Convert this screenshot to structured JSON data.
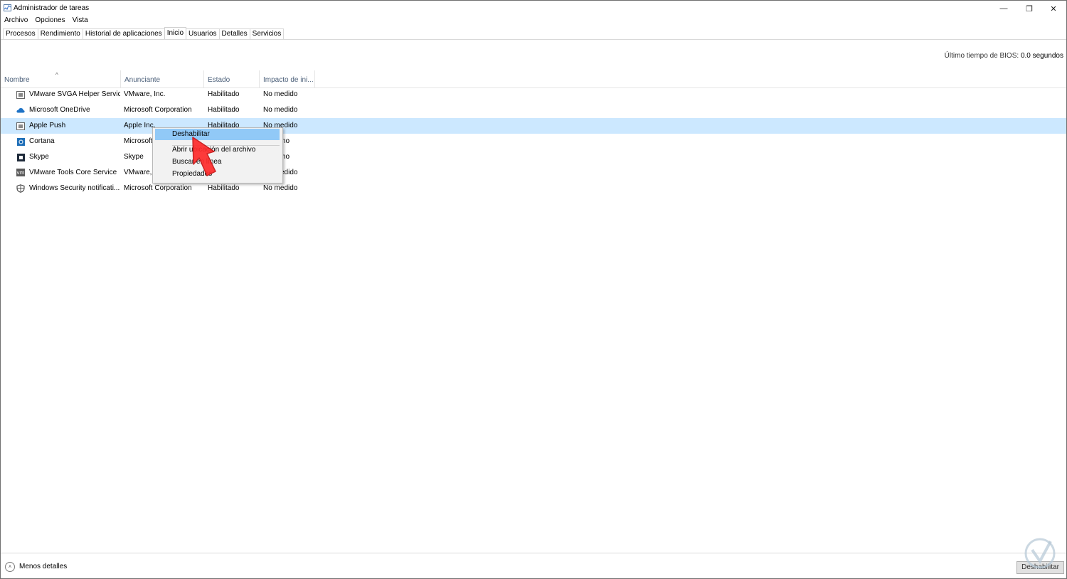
{
  "window": {
    "title": "Administrador de tareas",
    "minimize_glyph": "—",
    "restore_glyph": "❐",
    "close_glyph": "✕"
  },
  "menu": [
    "Archivo",
    "Opciones",
    "Vista"
  ],
  "tabs": [
    "Procesos",
    "Rendimiento",
    "Historial de aplicaciones",
    "Inicio",
    "Usuarios",
    "Detalles",
    "Servicios"
  ],
  "active_tab": "Inicio",
  "bios": {
    "label": "Último tiempo de BIOS:",
    "value": "0.0 segundos"
  },
  "columns": [
    "Nombre",
    "Anunciante",
    "Estado",
    "Impacto de ini..."
  ],
  "sort_glyph": "^",
  "rows": [
    {
      "icon": "vmware-svga-icon",
      "name": "VMware SVGA Helper Service",
      "publisher": "VMware, Inc.",
      "status": "Habilitado",
      "impact": "No medido"
    },
    {
      "icon": "onedrive-cloud-icon",
      "name": "Microsoft OneDrive",
      "publisher": "Microsoft Corporation",
      "status": "Habilitado",
      "impact": "No medido"
    },
    {
      "icon": "apple-push-icon",
      "name": "Apple Push",
      "publisher": "Apple Inc.",
      "status": "Habilitado",
      "impact": "No medido"
    },
    {
      "icon": "cortana-icon",
      "name": "Cortana",
      "publisher": "Microsoft",
      "status": "",
      "impact": "no"
    },
    {
      "icon": "skype-icon",
      "name": "Skype",
      "publisher": "Skype",
      "status": "",
      "impact": "no"
    },
    {
      "icon": "vmware-tools-icon",
      "name": "VMware Tools Core Service",
      "publisher": "VMware,",
      "status": "",
      "impact": "edido"
    },
    {
      "icon": "windows-security-shield-icon",
      "name": "Windows Security notificati...",
      "publisher": "Microsoft Corporation",
      "status": "Habilitado",
      "impact": "No medido"
    }
  ],
  "icon_glyphs": {
    "vm": "vm"
  },
  "context_menu": [
    "Deshabilitar",
    "Abrir ubicación del archivo",
    "Buscar en línea",
    "Propiedades"
  ],
  "footer": {
    "less_details": "Menos detalles",
    "less_glyph": "˄",
    "disable_button": "Deshabilitar"
  },
  "colors": {
    "selected_row": "#cce8ff",
    "menu_hover": "#91c9f7",
    "arrow": "#ff2b2b",
    "header_text": "#4c607a"
  }
}
